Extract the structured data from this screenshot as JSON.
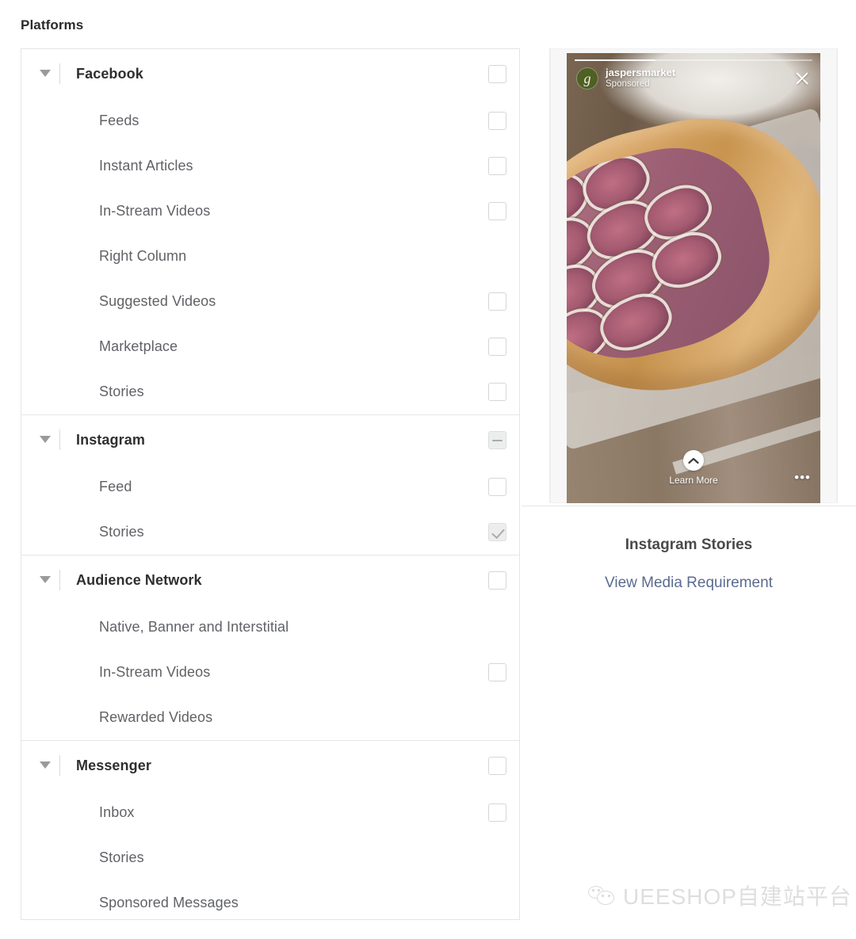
{
  "page": {
    "title": "Platforms"
  },
  "platforms": {
    "groups": [
      {
        "name": "Facebook",
        "checkbox": "unchecked",
        "expanded": true,
        "caret_icon": "caret-down-icon",
        "children": [
          {
            "name": "Feeds",
            "checkbox": "unchecked"
          },
          {
            "name": "Instant Articles",
            "checkbox": "unchecked"
          },
          {
            "name": "In-Stream Videos",
            "checkbox": "unchecked"
          },
          {
            "name": "Right Column",
            "checkbox": "none"
          },
          {
            "name": "Suggested Videos",
            "checkbox": "unchecked"
          },
          {
            "name": "Marketplace",
            "checkbox": "unchecked"
          },
          {
            "name": "Stories",
            "checkbox": "unchecked"
          }
        ]
      },
      {
        "name": "Instagram",
        "checkbox": "indeterminate",
        "expanded": true,
        "caret_icon": "caret-down-icon",
        "children": [
          {
            "name": "Feed",
            "checkbox": "unchecked"
          },
          {
            "name": "Stories",
            "checkbox": "checked"
          }
        ]
      },
      {
        "name": "Audience Network",
        "checkbox": "unchecked",
        "expanded": true,
        "caret_icon": "caret-down-icon",
        "children": [
          {
            "name": "Native, Banner and Interstitial",
            "checkbox": "none"
          },
          {
            "name": "In-Stream Videos",
            "checkbox": "unchecked"
          },
          {
            "name": "Rewarded Videos",
            "checkbox": "none"
          }
        ]
      },
      {
        "name": "Messenger",
        "checkbox": "unchecked",
        "expanded": true,
        "caret_icon": "caret-down-icon",
        "children": [
          {
            "name": "Inbox",
            "checkbox": "unchecked"
          },
          {
            "name": "Stories",
            "checkbox": "none"
          },
          {
            "name": "Sponsored Messages",
            "checkbox": "none"
          }
        ]
      }
    ]
  },
  "preview": {
    "story": {
      "avatar_letter": "g",
      "username": "jaspersmarket",
      "sponsored_label": "Sponsored",
      "close_icon": "close-icon",
      "cta_icon": "chevron-up-icon",
      "cta_label": "Learn More",
      "more_icon": "ellipsis-icon",
      "more_glyph": "•••"
    },
    "caption": "Instagram Stories",
    "link_label": "View Media Requirement"
  },
  "watermark": {
    "icon": "wechat-icon",
    "text": "UEESHOP自建站平台"
  },
  "colors": {
    "panel_border": "#e2e4e7",
    "group_label": "#2f2f2f",
    "child_label": "#606266",
    "link": "#5a6b91",
    "checkbox_border": "#d4d6da",
    "avatar_green": "#4e6024"
  }
}
